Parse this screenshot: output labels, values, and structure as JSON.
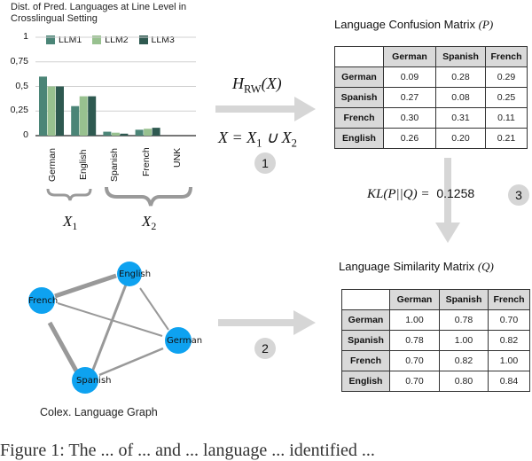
{
  "chart_data": {
    "type": "bar",
    "title": "Dist. of Pred. Languages at Line Level in Crosslingual Setting",
    "categories": [
      "German",
      "English",
      "Spanish",
      "French",
      "UNK"
    ],
    "series": [
      {
        "name": "LLM1",
        "color": "#4b8577",
        "values": [
          0.6,
          0.3,
          0.04,
          0.06,
          0.0
        ]
      },
      {
        "name": "LLM2",
        "color": "#98c18f",
        "values": [
          0.5,
          0.4,
          0.03,
          0.07,
          0.0
        ]
      },
      {
        "name": "LLM3",
        "color": "#2e5950",
        "values": [
          0.5,
          0.4,
          0.02,
          0.08,
          0.0
        ]
      }
    ],
    "yticks": [
      "0",
      "0,25",
      "0,5",
      "0,75",
      "1"
    ],
    "ylim": [
      0,
      1
    ],
    "xlabel": "",
    "ylabel": "",
    "grid": true,
    "legend_position": "top"
  },
  "groups": {
    "x1": {
      "label": "X",
      "sub": "1",
      "members": [
        "German",
        "English"
      ]
    },
    "x2": {
      "label": "X",
      "sub": "2",
      "members": [
        "Spanish",
        "French",
        "UNK"
      ]
    }
  },
  "step1": {
    "top_formula": {
      "main": "H",
      "sub": "RW",
      "tail": "(X)"
    },
    "bottom_formula": {
      "lhs": "X = ",
      "a": "X",
      "a_sub": "1",
      "op": " ∪ ",
      "b": "X",
      "b_sub": "2"
    },
    "badge": "1"
  },
  "step2": {
    "badge": "2"
  },
  "step3": {
    "formula": "KL(P||Q) =",
    "value": "0.1258",
    "badge": "3"
  },
  "confusion_matrix": {
    "title": "Language Confusion Matrix",
    "symbol": "(P)",
    "columns": [
      "German",
      "Spanish",
      "French"
    ],
    "rows": [
      {
        "label": "German",
        "values": [
          "0.09",
          "0.28",
          "0.29"
        ]
      },
      {
        "label": "Spanish",
        "values": [
          "0.27",
          "0.08",
          "0.25"
        ]
      },
      {
        "label": "French",
        "values": [
          "0.30",
          "0.31",
          "0.11"
        ]
      },
      {
        "label": "English",
        "values": [
          "0.26",
          "0.20",
          "0.21"
        ]
      }
    ]
  },
  "similarity_matrix": {
    "title": "Language Similarity Matrix",
    "symbol": "(Q)",
    "columns": [
      "German",
      "Spanish",
      "French"
    ],
    "rows": [
      {
        "label": "German",
        "values": [
          "1.00",
          "0.78",
          "0.70"
        ]
      },
      {
        "label": "Spanish",
        "values": [
          "0.78",
          "1.00",
          "0.82"
        ]
      },
      {
        "label": "French",
        "values": [
          "0.70",
          "0.82",
          "1.00"
        ]
      },
      {
        "label": "English",
        "values": [
          "0.70",
          "0.80",
          "0.84"
        ]
      }
    ]
  },
  "graph": {
    "caption": "Colex. Language Graph",
    "node_color": "#0ea2f0",
    "edge_color": "#999999",
    "nodes": [
      "English",
      "French",
      "German",
      "Spanish"
    ],
    "edges": [
      {
        "from": "French",
        "to": "English",
        "weight": "strong"
      },
      {
        "from": "French",
        "to": "Spanish",
        "weight": "strong"
      },
      {
        "from": "English",
        "to": "Spanish",
        "weight": "medium"
      },
      {
        "from": "French",
        "to": "German",
        "weight": "weak"
      },
      {
        "from": "English",
        "to": "German",
        "weight": "weak"
      },
      {
        "from": "Spanish",
        "to": "German",
        "weight": "weak"
      }
    ]
  },
  "figure_caption": "Figure 1: The ... of ... and ... language ... identified ..."
}
